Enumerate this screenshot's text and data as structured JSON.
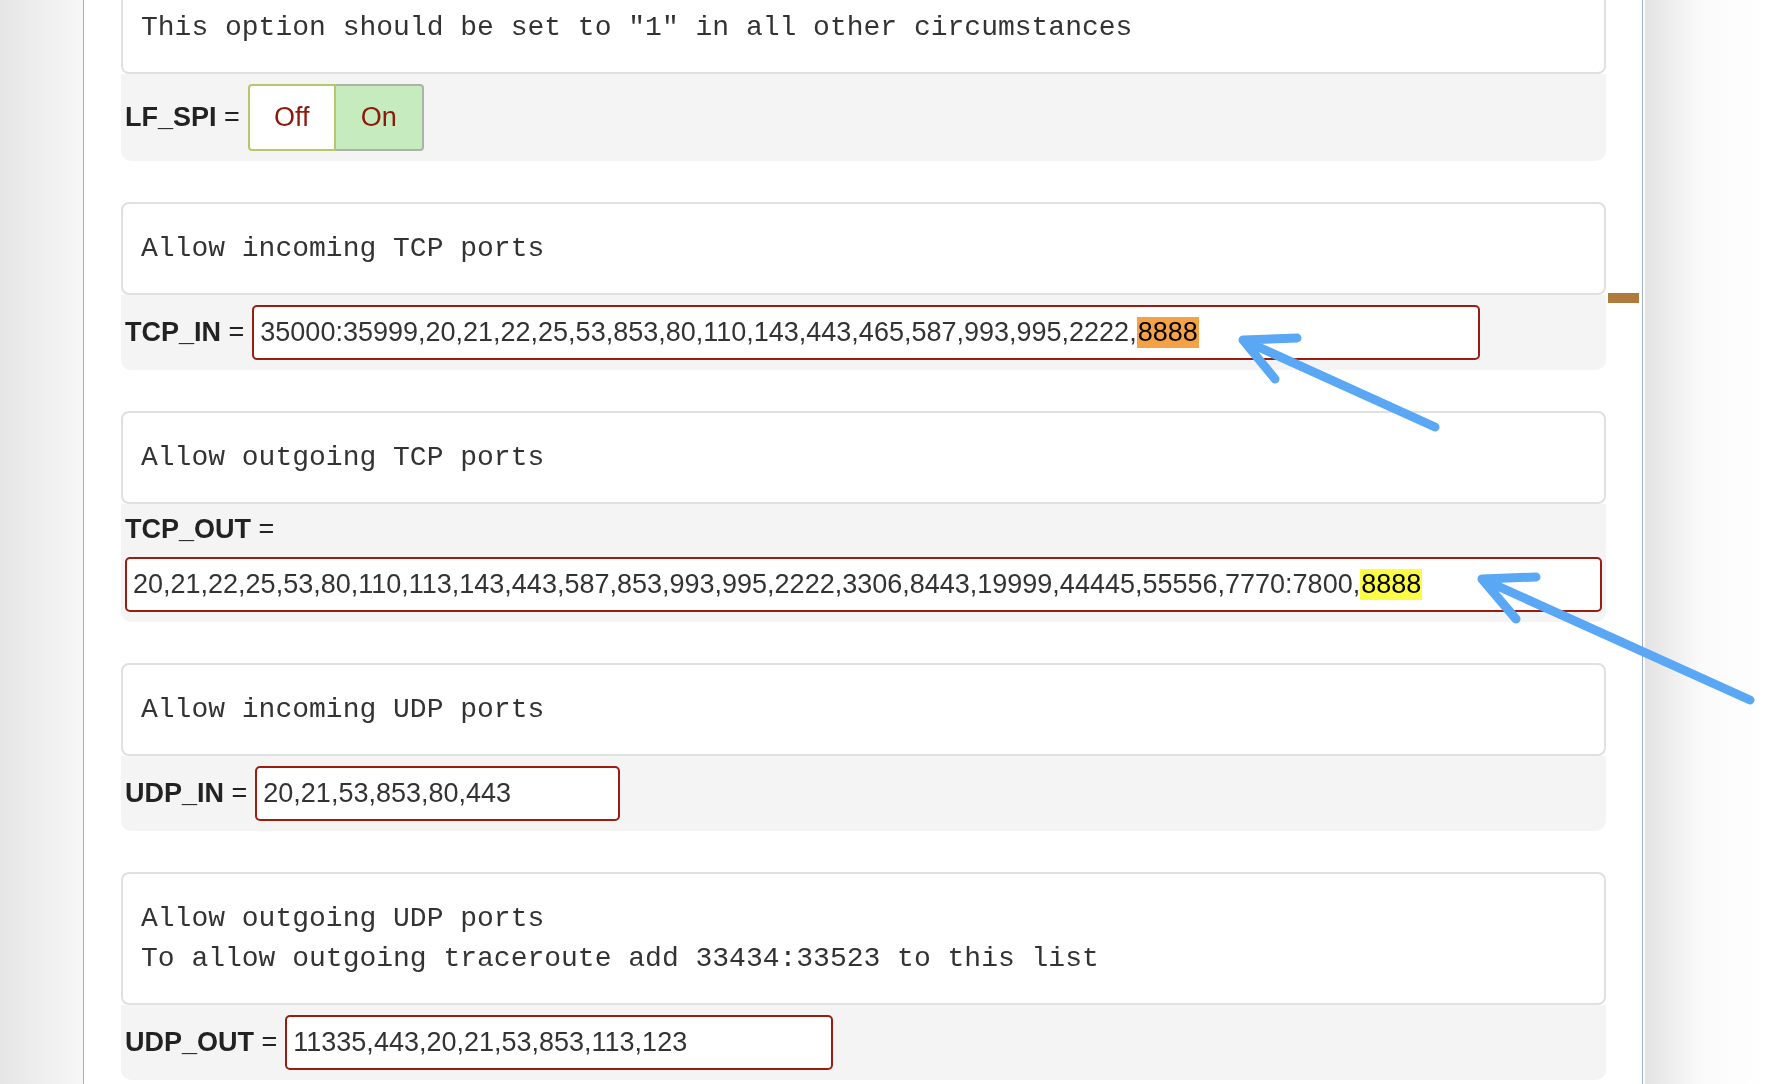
{
  "settings": [
    {
      "kind": "toggle",
      "description": [
        "This option should be set to \"1\" in all other circumstances"
      ],
      "name": "**LF_SPI** =",
      "options": [
        {
          "label": "Off",
          "selected": false
        },
        {
          "label": "On",
          "selected": true
        }
      ]
    },
    {
      "kind": "field",
      "description": [
        "Allow incoming TCP ports"
      ],
      "name": "**TCP_IN** =",
      "value": "35000:35999,20,21,22,25,53,853,80,110,143,443,465,587,993,995,2222,",
      "highlight": {
        "text": "8888",
        "color": "#f4a245"
      }
    },
    {
      "kind": "field",
      "description": [
        "Allow outgoing TCP ports"
      ],
      "name": "**TCP_OUT** =",
      "value": "20,21,22,25,53,80,110,113,143,443,587,853,993,995,2222,3306,8443,19999,44445,55556,7770:7800,",
      "highlight": {
        "text": "8888",
        "color": "#fcfc47"
      }
    },
    {
      "kind": "field",
      "description": [
        "Allow incoming UDP ports"
      ],
      "name": "**UDP_IN** =",
      "value": "20,21,53,853,80,443"
    },
    {
      "kind": "field",
      "description": [
        "Allow outgoing UDP ports",
        "To allow outgoing traceroute add 33434:33523 to this list"
      ],
      "name": "**UDP_OUT** =",
      "value": "11335,443,20,21,53,853,113,123"
    }
  ]
}
